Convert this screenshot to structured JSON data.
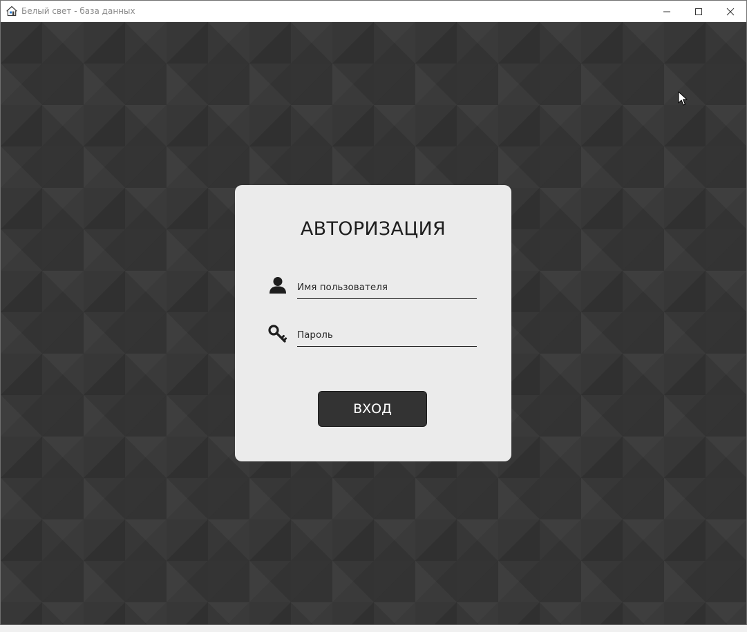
{
  "window": {
    "title": "Белый свет - база данных",
    "app_icon": "house-icon",
    "controls": {
      "minimize": "minimize-icon",
      "maximize": "maximize-icon",
      "close": "close-icon"
    }
  },
  "login": {
    "title": "АВТОРИЗАЦИЯ",
    "username": {
      "placeholder": "Имя пользователя",
      "value": "",
      "icon": "user-icon"
    },
    "password": {
      "placeholder": "Пароль",
      "value": "",
      "icon": "key-icon"
    },
    "submit_label": "ВХОД"
  },
  "colors": {
    "background": "#333333",
    "panel": "#ebebeb",
    "button": "#333333",
    "button_text": "#ffffff",
    "text": "#1e1e1e"
  }
}
